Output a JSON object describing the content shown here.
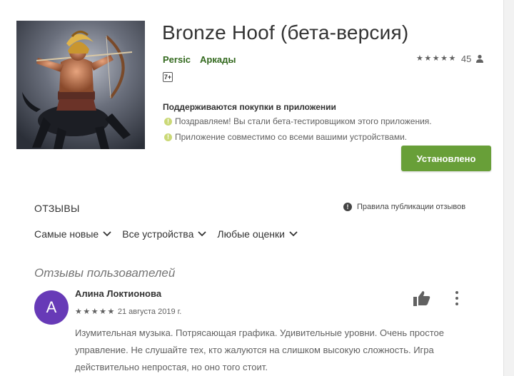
{
  "app": {
    "title": "Bronze Hoof (бета-версия)",
    "developer": "Persic",
    "category": "Аркады",
    "rating_count": "45",
    "stars_filled": 5,
    "content_rating": "7+",
    "in_app_purchases": "Поддерживаются покупки в приложении",
    "info_lines": [
      "Поздравляем! Вы стали бета-тестировщиком этого приложения.",
      "Приложение совместимо со всеми вашими устройствами."
    ],
    "install_label": "Установлено",
    "accent_color": "#689f38",
    "link_color": "#33691e"
  },
  "reviews": {
    "heading": "ОТЗЫВЫ",
    "policy_label": "Правила публикации отзывов",
    "filters": [
      "Самые новые",
      "Все устройства",
      "Любые оценки"
    ],
    "section_title": "Отзывы пользователей",
    "items": [
      {
        "avatar_letter": "А",
        "avatar_color": "#673ab7",
        "author": "Алина Локтионова",
        "stars": 5,
        "date": "21 августа 2019 г.",
        "text": "Изумительная музыка. Потрясающая графика. Удивительные уровни. Очень простое управление. Не слушайте тех, кто жалуются на слишком высокую сложность. Игра действительно непростая, но оно того стоит."
      }
    ]
  },
  "icons": {
    "star": "★",
    "check": "!",
    "info": "!"
  }
}
